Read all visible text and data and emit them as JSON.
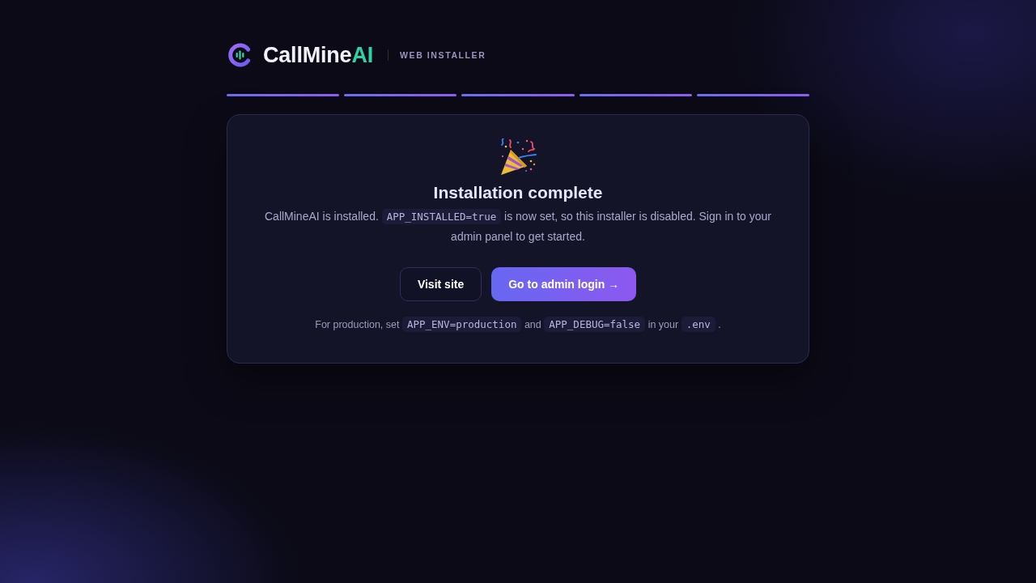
{
  "header": {
    "brand": "CallMine",
    "brand_accent": "AI",
    "subtitle": "WEB INSTALLER"
  },
  "steps": [
    {
      "done": true
    },
    {
      "done": true
    },
    {
      "done": true
    },
    {
      "done": true
    },
    {
      "done": true
    }
  ],
  "card": {
    "title": "Installation complete",
    "message": [
      {
        "kind": "text",
        "text": "CallMineAI is installed."
      },
      {
        "kind": "code",
        "text": "APP_INSTALLED=true"
      },
      {
        "kind": "text",
        "text": "is now set, so this installer is disabled. Sign in to your admin panel to get started."
      }
    ],
    "buttons": [
      {
        "kind": "secondary",
        "label": "Visit site"
      },
      {
        "kind": "primary",
        "label": "Go to admin login →"
      }
    ],
    "note": [
      {
        "kind": "text",
        "text": "For production, set"
      },
      {
        "kind": "code",
        "text": "APP_ENV=production"
      },
      {
        "kind": "text",
        "text": "and"
      },
      {
        "kind": "code",
        "text": "APP_DEBUG=false"
      },
      {
        "kind": "text",
        "text": "in your"
      },
      {
        "kind": "code",
        "text": ".env"
      },
      {
        "kind": "text",
        "text": "."
      }
    ]
  }
}
